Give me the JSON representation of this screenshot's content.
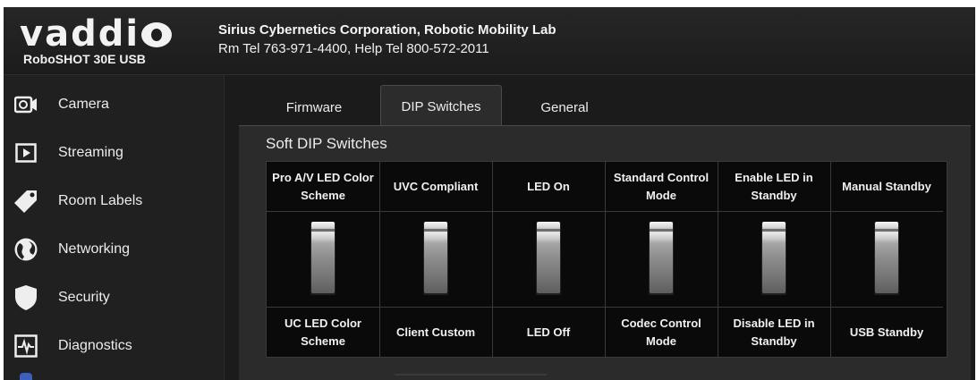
{
  "header": {
    "brand": "vaddi",
    "model": "RoboSHOT 30E USB",
    "company": "Sirius Cybernetics Corporation, Robotic Mobility Lab",
    "phones": "Rm Tel 763-971-4400, Help Tel 800-572-2011"
  },
  "sidebar": {
    "items": [
      {
        "label": "Camera",
        "icon": "camera-icon"
      },
      {
        "label": "Streaming",
        "icon": "play-icon"
      },
      {
        "label": "Room Labels",
        "icon": "tag-icon"
      },
      {
        "label": "Networking",
        "icon": "globe-icon"
      },
      {
        "label": "Security",
        "icon": "shield-icon"
      },
      {
        "label": "Diagnostics",
        "icon": "pulse-icon"
      }
    ]
  },
  "tabs": [
    {
      "label": "Firmware",
      "active": false
    },
    {
      "label": "DIP Switches",
      "active": true
    },
    {
      "label": "General",
      "active": false
    }
  ],
  "panel": {
    "title": "Soft DIP Switches",
    "switches": [
      {
        "top": "Pro A/V LED Color Scheme",
        "bottom": "UC LED Color Scheme"
      },
      {
        "top": "UVC Compliant",
        "bottom": "Client Custom"
      },
      {
        "top": "LED On",
        "bottom": "LED Off"
      },
      {
        "top": "Standard Control Mode",
        "bottom": "Codec Control Mode"
      },
      {
        "top": "Enable LED in Standby",
        "bottom": "Disable LED in Standby"
      },
      {
        "top": "Manual Standby",
        "bottom": "USB Standby"
      }
    ]
  }
}
